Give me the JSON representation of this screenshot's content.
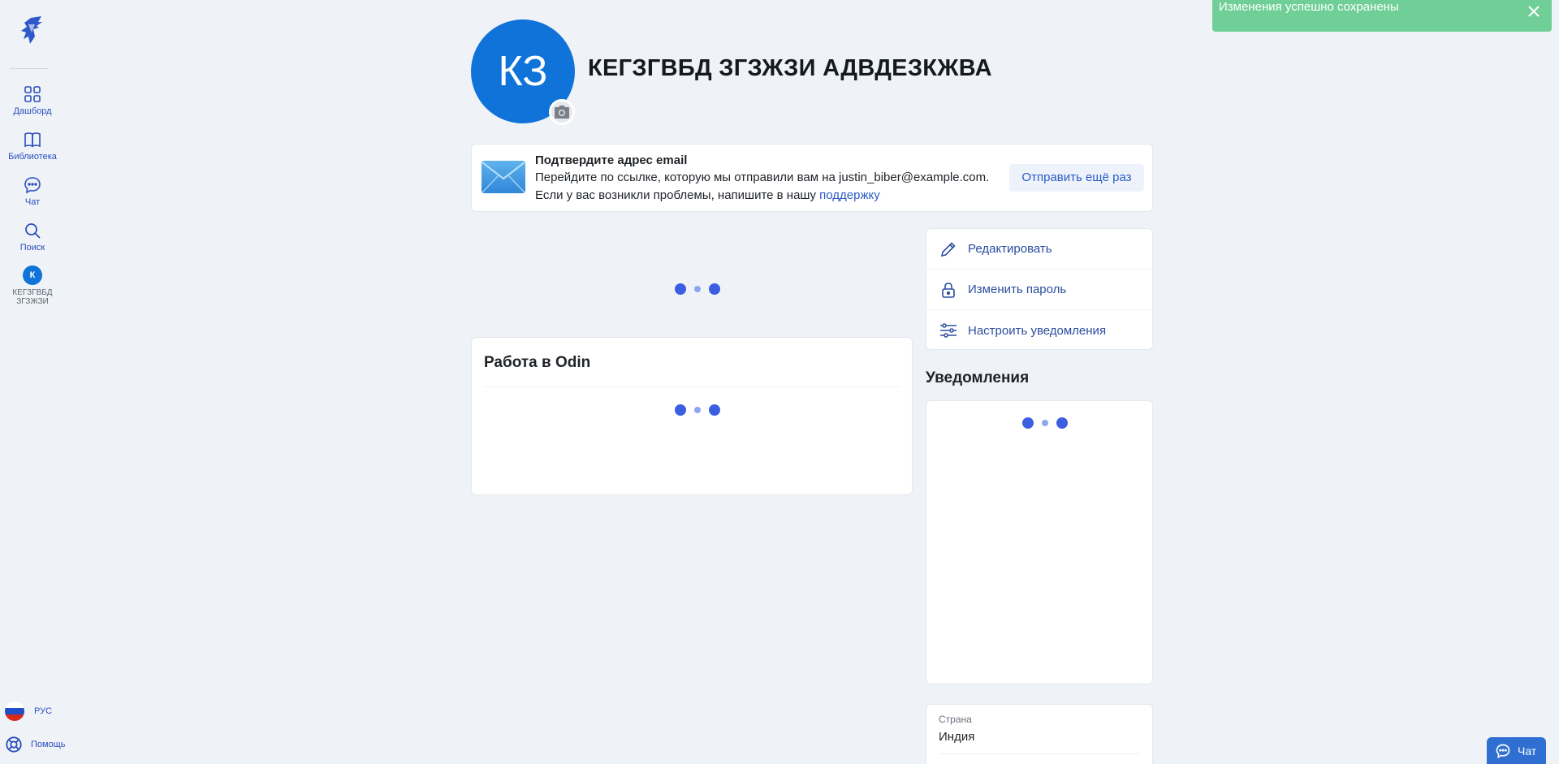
{
  "sidebar": {
    "items": [
      {
        "label": "Дашборд",
        "icon": "dashboard-icon"
      },
      {
        "label": "Библиотека",
        "icon": "book-icon"
      },
      {
        "label": "Чат",
        "icon": "chat-bubble-icon"
      },
      {
        "label": "Поиск",
        "icon": "search-icon"
      }
    ],
    "profile": {
      "initial": "К",
      "label_line1": "КЕГЗГВБД",
      "label_line2": "ЗГЗЖЗИ"
    },
    "language": {
      "label": "РУС"
    },
    "help": {
      "label": "Помощь"
    }
  },
  "header": {
    "avatar_initials": "КЗ",
    "user_name": "КЕГЗГВБД ЗГЗЖЗИ АДВДЕЗКЖВА"
  },
  "verify_email": {
    "title": "Подтвердите адрес email",
    "line1": "Перейдите по ссылке, которую мы отправили вам на justin_biber@example.com.",
    "line2_prefix": "Если у вас возникли проблемы, напишите в нашу ",
    "support_link": "поддержку",
    "resend_button": "Отправить ещё раз"
  },
  "work_card": {
    "title": "Работа в Odin"
  },
  "actions": [
    {
      "label": "Редактировать",
      "icon": "pencil-icon"
    },
    {
      "label": "Изменить пароль",
      "icon": "lock-icon"
    },
    {
      "label": "Настроить уведомления",
      "icon": "sliders-icon"
    }
  ],
  "notifications": {
    "title": "Уведомления"
  },
  "info": {
    "country_label": "Страна",
    "country_value": "Индия"
  },
  "toast": {
    "message": "Изменения успешно сохранены"
  },
  "chat_fab": {
    "label": "Чат"
  },
  "colors": {
    "accent": "#2b4dbf",
    "avatar": "#0f73d9",
    "toast": "#6fcf97",
    "background": "#eff3f7"
  }
}
